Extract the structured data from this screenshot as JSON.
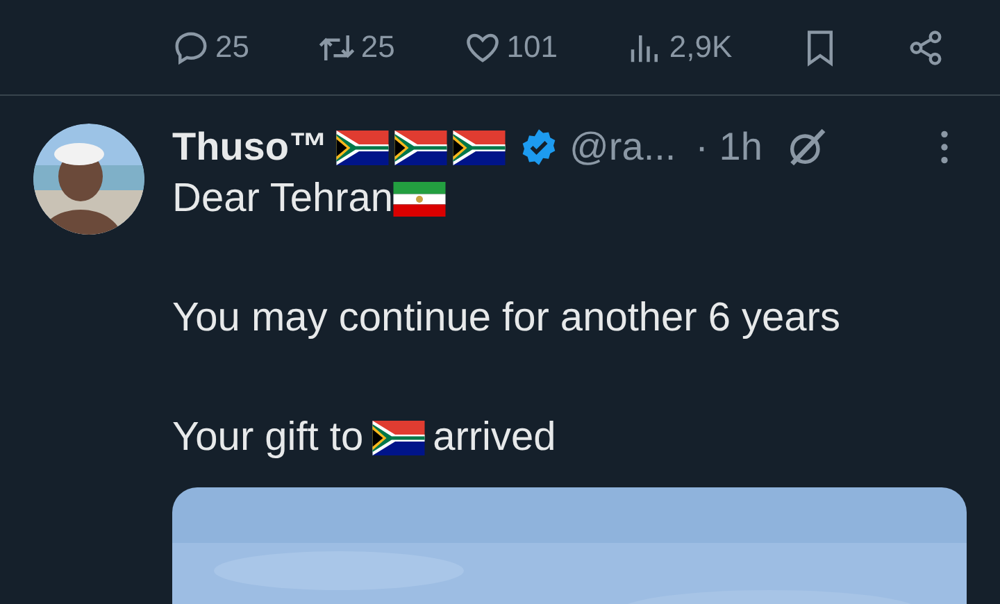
{
  "actions": [
    {
      "kind": "reply",
      "count": "25"
    },
    {
      "kind": "repost",
      "count": "25"
    },
    {
      "kind": "like",
      "count": "101"
    },
    {
      "kind": "views",
      "count": "2,9K"
    },
    {
      "kind": "bookmark"
    },
    {
      "kind": "share"
    }
  ],
  "post": {
    "author": {
      "name": "Thuso™",
      "flags": [
        {
          "kind": "flag_za"
        },
        {
          "kind": "flag_za"
        },
        {
          "kind": "flag_za"
        }
      ],
      "verified": true,
      "handle": "@ra...",
      "time": "· 1h"
    },
    "paragraphs": [
      [
        {
          "kind": "text",
          "text": "Dear Tehran"
        },
        {
          "kind": "flag_ir"
        }
      ],
      [
        {
          "kind": "text",
          "text": "You may continue for another 6 years"
        }
      ],
      [
        {
          "kind": "text",
          "text": "Your gift to"
        },
        {
          "kind": "flag_za"
        },
        {
          "kind": "text",
          "text": "arrived"
        }
      ]
    ],
    "media": {
      "kind": "picture"
    }
  }
}
